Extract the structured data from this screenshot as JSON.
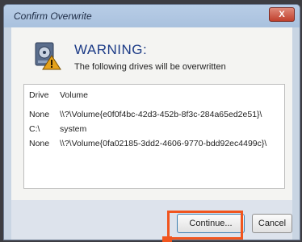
{
  "dialog": {
    "title": "Confirm Overwrite",
    "close_label": "X",
    "heading": "WARNING:",
    "message": "The following drives will be overwritten",
    "icon": "drive-warning-icon"
  },
  "drive_table": {
    "columns": [
      "Drive",
      "Volume"
    ],
    "rows": [
      {
        "drive": "None",
        "volume": "\\\\?\\Volume{e0f0f4bc-42d3-452b-8f3c-284a65ed2e51}\\"
      },
      {
        "drive": "C:\\",
        "volume": "system"
      },
      {
        "drive": "None",
        "volume": "\\\\?\\Volume{0fa02185-3dd2-4606-9770-bdd92ec4499c}\\"
      }
    ]
  },
  "buttons": {
    "continue_label": "Continue...",
    "cancel_label": "Cancel"
  },
  "colors": {
    "highlight": "#f1551e",
    "heading": "#1b3a86",
    "close": "#c0402d"
  }
}
